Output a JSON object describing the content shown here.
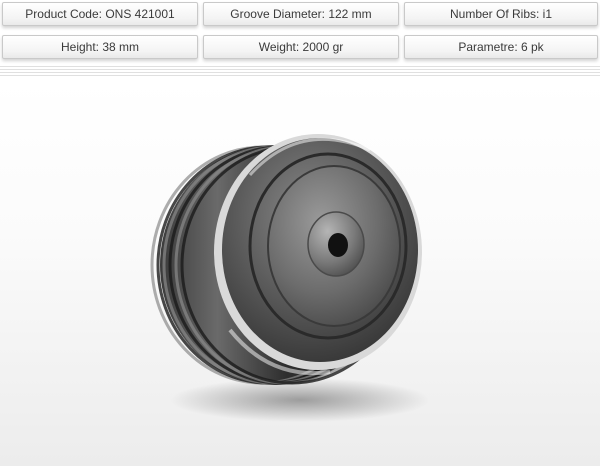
{
  "specs": {
    "row1": [
      {
        "label": "Product Code: ONS 421001"
      },
      {
        "label": "Groove Diameter: 122 mm"
      },
      {
        "label": "Number Of Ribs: i1"
      }
    ],
    "row2": [
      {
        "label": "Height: 38 mm"
      },
      {
        "label": "Weight: 2000 gr"
      },
      {
        "label": "Parametre: 6 pk"
      }
    ]
  },
  "product_image": {
    "subject": "pulley-wheel",
    "colors": {
      "body": "#5a5a5a",
      "highlight": "#cfcfcf",
      "shadow": "#2a2a2a"
    }
  }
}
